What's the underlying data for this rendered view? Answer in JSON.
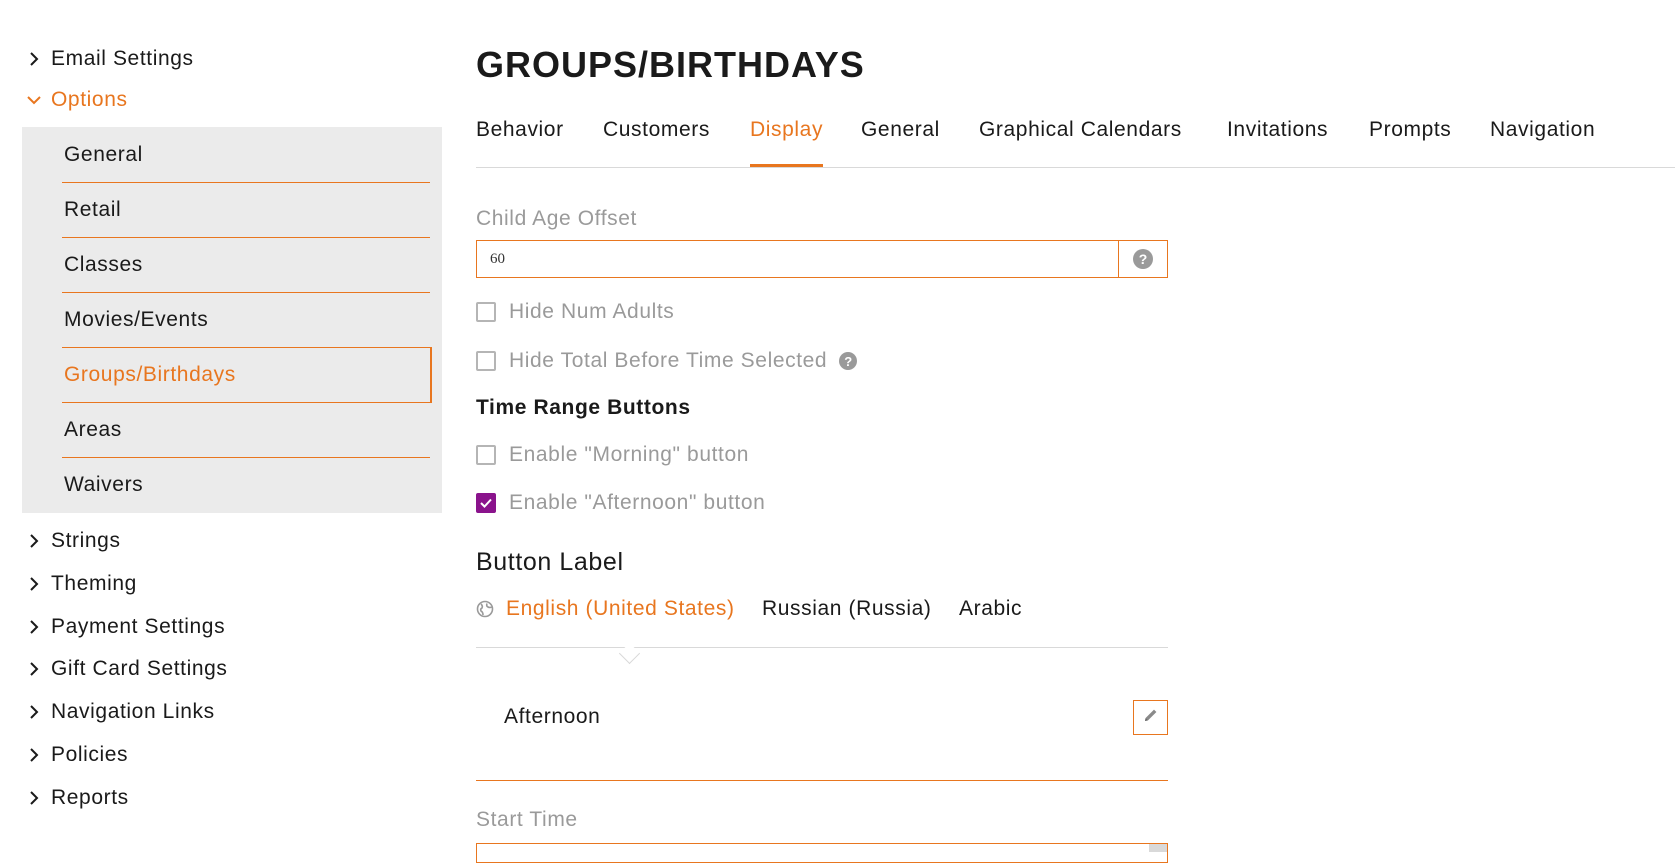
{
  "sidebar": {
    "items_top": [
      {
        "label": "Email Settings",
        "icon": "chevron-right-icon"
      },
      {
        "label": "Options",
        "icon": "chevron-down-icon",
        "open": true
      }
    ],
    "submenu": [
      {
        "label": "General"
      },
      {
        "label": "Retail"
      },
      {
        "label": "Classes"
      },
      {
        "label": "Movies/Events"
      },
      {
        "label": "Groups/Birthdays",
        "active": true
      },
      {
        "label": "Areas"
      },
      {
        "label": "Waivers"
      }
    ],
    "items_bottom": [
      {
        "label": "Strings",
        "icon": "chevron-right-icon"
      },
      {
        "label": "Theming",
        "icon": "chevron-right-icon"
      },
      {
        "label": "Payment Settings",
        "icon": "chevron-right-icon"
      },
      {
        "label": "Gift Card Settings",
        "icon": "chevron-right-icon"
      },
      {
        "label": "Navigation Links",
        "icon": "chevron-right-icon"
      },
      {
        "label": "Policies",
        "icon": "chevron-right-icon"
      },
      {
        "label": "Reports",
        "icon": "chevron-right-icon"
      }
    ]
  },
  "page": {
    "title": "GROUPS/BIRTHDAYS",
    "tabs": [
      {
        "label": "Behavior"
      },
      {
        "label": "Customers"
      },
      {
        "label": "Display",
        "active": true
      },
      {
        "label": "General"
      },
      {
        "label": "Graphical Calendars"
      },
      {
        "label": "Invitations"
      },
      {
        "label": "Prompts"
      },
      {
        "label": "Navigation"
      }
    ]
  },
  "form": {
    "child_age_offset": {
      "label": "Child Age Offset",
      "value": "60",
      "help_icon": "question-circle-icon",
      "help_glyph": "?"
    },
    "hide_num_adults": {
      "label": "Hide Num Adults",
      "checked": false
    },
    "hide_total_before_time": {
      "label": "Hide Total Before Time Selected",
      "checked": false,
      "help_icon": "question-circle-icon",
      "help_glyph": "?"
    },
    "time_range_title": "Time Range Buttons",
    "enable_morning": {
      "label": "Enable \"Morning\" button",
      "checked": false
    },
    "enable_afternoon": {
      "label": "Enable \"Afternoon\" button",
      "checked": true
    },
    "button_label_title": "Button Label",
    "languages": [
      {
        "label": "English (United States)",
        "active": true,
        "icon": "globe-icon"
      },
      {
        "label": "Russian (Russia)"
      },
      {
        "label": "Arabic"
      }
    ],
    "button_label_value": "Afternoon",
    "start_time_label": "Start Time"
  },
  "colors": {
    "accent": "#e8761f",
    "checkbox_checked": "#8a138c",
    "muted_text": "#9a9a9a",
    "submenu_bg": "#ebebeb"
  }
}
